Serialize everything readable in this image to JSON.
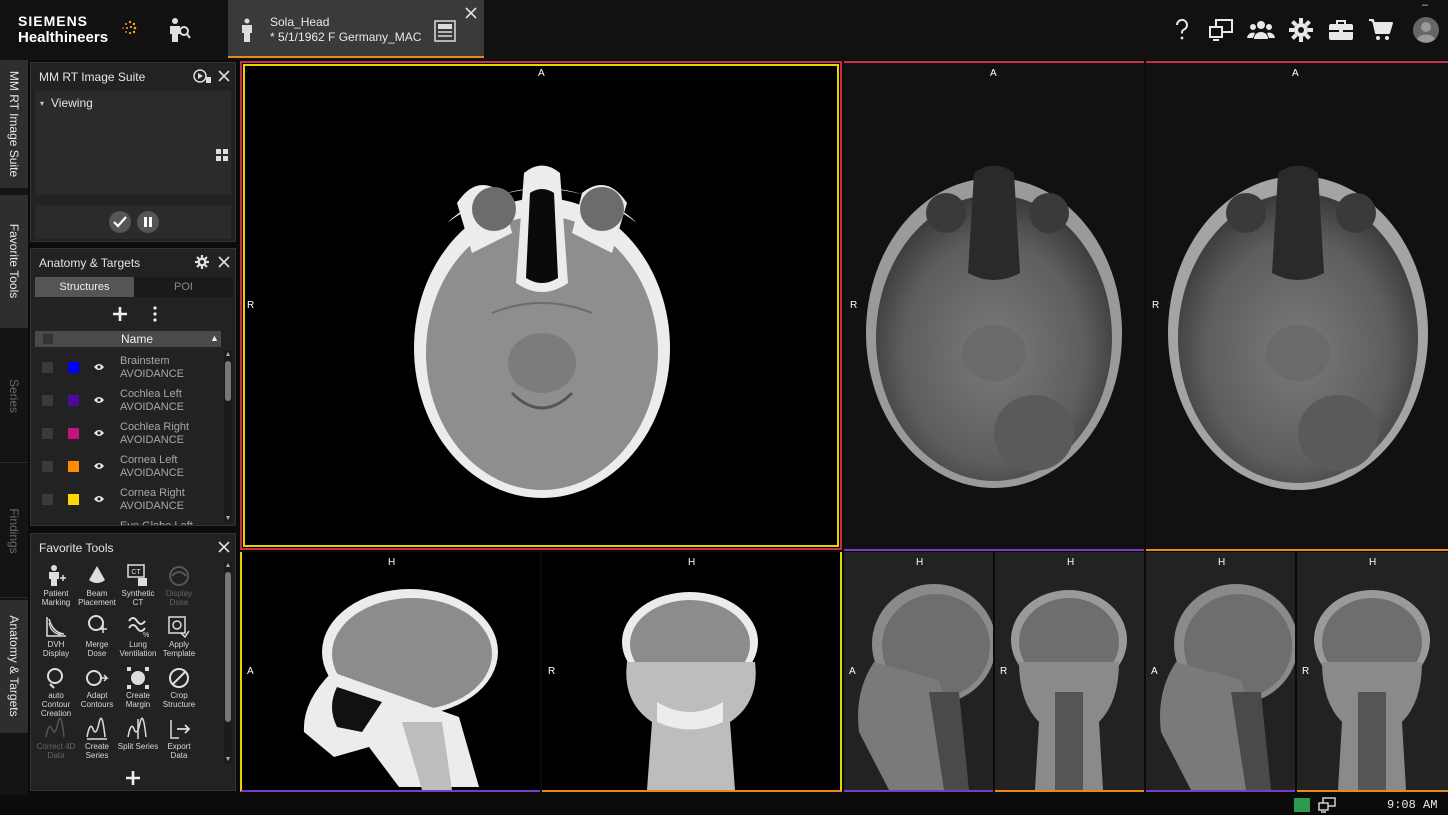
{
  "brand": {
    "line1": "SIEMENS",
    "line2": "Healthineers"
  },
  "patient_tab": {
    "name": "Sola_Head",
    "info": "* 5/1/1962 F Germany_MAC"
  },
  "side_tabs": [
    "MM RT Image Suite",
    "Favorite Tools",
    "Series",
    "Findings",
    "Anatomy & Targets"
  ],
  "suite_panel": {
    "title": "MM RT Image Suite",
    "section": "Viewing"
  },
  "anatomy_panel": {
    "title": "Anatomy & Targets",
    "tabs": [
      "Structures",
      "POI"
    ],
    "column_name": "Name",
    "structures": [
      {
        "name": "Brainstem",
        "type": "AVOIDANCE",
        "color": "#0000ff"
      },
      {
        "name": "Cochlea Left",
        "type": "AVOIDANCE",
        "color": "#4b0a9a"
      },
      {
        "name": "Cochlea Right",
        "type": "AVOIDANCE",
        "color": "#c4147a"
      },
      {
        "name": "Cornea Left",
        "type": "AVOIDANCE",
        "color": "#ff8c00"
      },
      {
        "name": "Cornea Right",
        "type": "AVOIDANCE",
        "color": "#ffd700"
      },
      {
        "name": "Eye Globe Left",
        "type": "AVOIDANCE",
        "color": "#00b050"
      }
    ]
  },
  "favorite_panel": {
    "title": "Favorite Tools",
    "tools": [
      {
        "l1": "Patient",
        "l2": "Marking",
        "enabled": true
      },
      {
        "l1": "Beam",
        "l2": "Placement",
        "enabled": true
      },
      {
        "l1": "Synthetic",
        "l2": "CT",
        "enabled": true
      },
      {
        "l1": "Display",
        "l2": "Dose",
        "enabled": false
      },
      {
        "l1": "DVH",
        "l2": "Display",
        "enabled": true
      },
      {
        "l1": "Merge",
        "l2": "Dose",
        "enabled": true
      },
      {
        "l1": "Lung",
        "l2": "Ventilation",
        "enabled": true
      },
      {
        "l1": "Apply",
        "l2": "Template",
        "enabled": true
      },
      {
        "l1": "auto",
        "l2": "Contour",
        "l3": "Creation",
        "enabled": true
      },
      {
        "l1": "Adapt",
        "l2": "Contours",
        "enabled": true
      },
      {
        "l1": "Create",
        "l2": "Margin",
        "enabled": true
      },
      {
        "l1": "Crop",
        "l2": "Structure",
        "enabled": true
      },
      {
        "l1": "Correct 4D",
        "l2": "Data",
        "enabled": false
      },
      {
        "l1": "Create",
        "l2": "Series",
        "enabled": true
      },
      {
        "l1": "Split Series",
        "l2": "",
        "enabled": true
      },
      {
        "l1": "Export",
        "l2": "Data",
        "enabled": true
      }
    ]
  },
  "viewports": {
    "ct_axial": {
      "top": "A",
      "left": "R"
    },
    "mr1_axial": {
      "top": "A",
      "left": "R"
    },
    "mr2_axial": {
      "top": "A",
      "left": "R"
    },
    "ct_sag": {
      "top": "H",
      "left": "A"
    },
    "ct_cor": {
      "top": "H",
      "left": "R"
    },
    "mr1_sag": {
      "top": "H",
      "left": "A"
    },
    "mr1_cor": {
      "top": "H",
      "left": "R"
    },
    "mr2_sag": {
      "top": "H",
      "left": "A"
    },
    "mr2_cor": {
      "top": "H",
      "left": "R"
    }
  },
  "status": {
    "time": "9:08 AM"
  },
  "colors": {
    "accent": "#e48a1e",
    "active_border": "#c7304a",
    "yellow": "#e6d400",
    "purple": "#7a3cc8"
  }
}
